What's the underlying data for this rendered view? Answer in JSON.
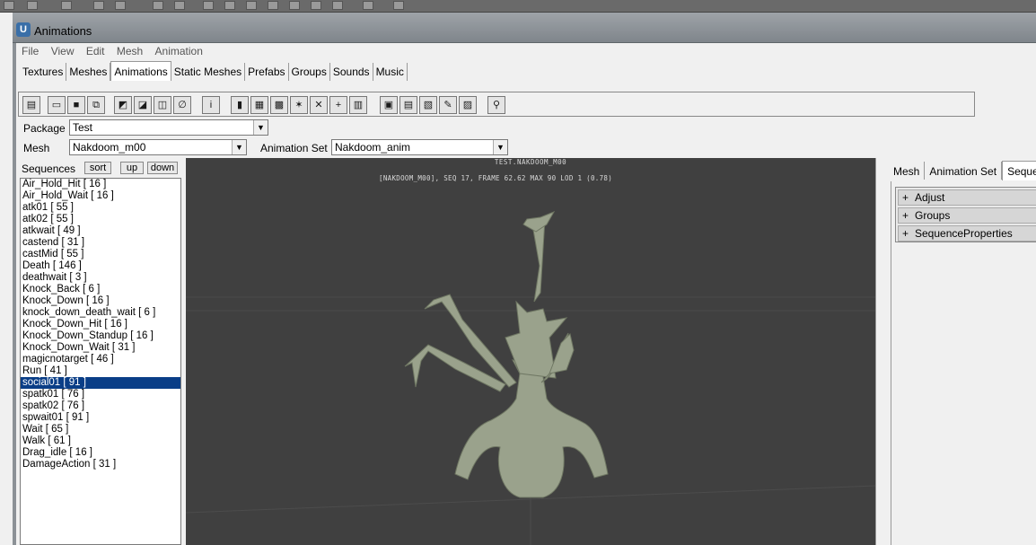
{
  "window": {
    "title": "Animations"
  },
  "menu": [
    "File",
    "View",
    "Edit",
    "Mesh",
    "Animation"
  ],
  "tabs": [
    {
      "label": "Textures",
      "active": false
    },
    {
      "label": "Meshes",
      "active": false
    },
    {
      "label": "Animations",
      "active": true
    },
    {
      "label": "Static Meshes",
      "active": false
    },
    {
      "label": "Prefabs",
      "active": false
    },
    {
      "label": "Groups",
      "active": false
    },
    {
      "label": "Sounds",
      "active": false
    },
    {
      "label": "Music",
      "active": false
    }
  ],
  "toolbar": {
    "icons": [
      "browser-icon",
      "open-icon",
      "save-icon",
      "copy-icon",
      "import-icon",
      "import-mesh-icon",
      "import-anim-icon",
      "link-icon",
      "info-icon",
      "book-icon",
      "mesh-view-icon",
      "grid-icon",
      "skeleton-icon",
      "bone-icon",
      "socket-icon",
      "lod-icon",
      "properties-icon",
      "sequence-icon",
      "notify-icon",
      "edit-icon",
      "clipboard-icon",
      "search-icon"
    ]
  },
  "package": {
    "label": "Package",
    "value": "Test"
  },
  "mesh": {
    "label": "Mesh",
    "value": "Nakdoom_m00"
  },
  "animset": {
    "label": "Animation Set",
    "value": "Nakdoom_anim"
  },
  "sequences": {
    "label": "Sequences",
    "sort_label": "sort",
    "up_label": "up",
    "down_label": "down",
    "selected_index": 16,
    "items": [
      "Air_Hold_Hit [ 16 ]",
      "Air_Hold_Wait [ 16 ]",
      "atk01 [ 55 ]",
      "atk02 [ 55 ]",
      "atkwait [ 49 ]",
      "castend [ 31 ]",
      "castMid [ 55 ]",
      "Death [ 146 ]",
      "deathwait [ 3 ]",
      "Knock_Back [ 6 ]",
      "Knock_Down [ 16 ]",
      "knock_down_death_wait [ 6 ]",
      "Knock_Down_Hit [ 16 ]",
      "Knock_Down_Standup [ 16 ]",
      "Knock_Down_Wait [ 31 ]",
      "magicnotarget [ 46 ]",
      "Run [ 41 ]",
      "social01 [ 91 ]",
      "spatk01 [ 76 ]",
      "spatk02 [ 76 ]",
      "spwait01 [ 91 ]",
      "Wait [ 65 ]",
      "Walk [ 61 ]",
      "Drag_idle [ 16 ]",
      "DamageAction [ 31 ]"
    ]
  },
  "viewport": {
    "title": "TEST.NAKDOOM_M00",
    "stats": "[NAKDOOM_M00], SEQ 17,  FRAME 62.62 MAX 90  LOD 1 (0.78)",
    "bg_color": "#404040"
  },
  "right_tabs": [
    {
      "label": "Mesh",
      "active": false
    },
    {
      "label": "Animation Set",
      "active": false
    },
    {
      "label": "Sequenc",
      "active": true
    }
  ],
  "properties": [
    {
      "label": "Adjust",
      "expander": "+"
    },
    {
      "label": "Groups",
      "expander": "+"
    },
    {
      "label": "SequenceProperties",
      "expander": "+"
    }
  ],
  "colors": {
    "selection": "#0a3e87",
    "viewport": "#404040",
    "model": "#9aa28c"
  }
}
